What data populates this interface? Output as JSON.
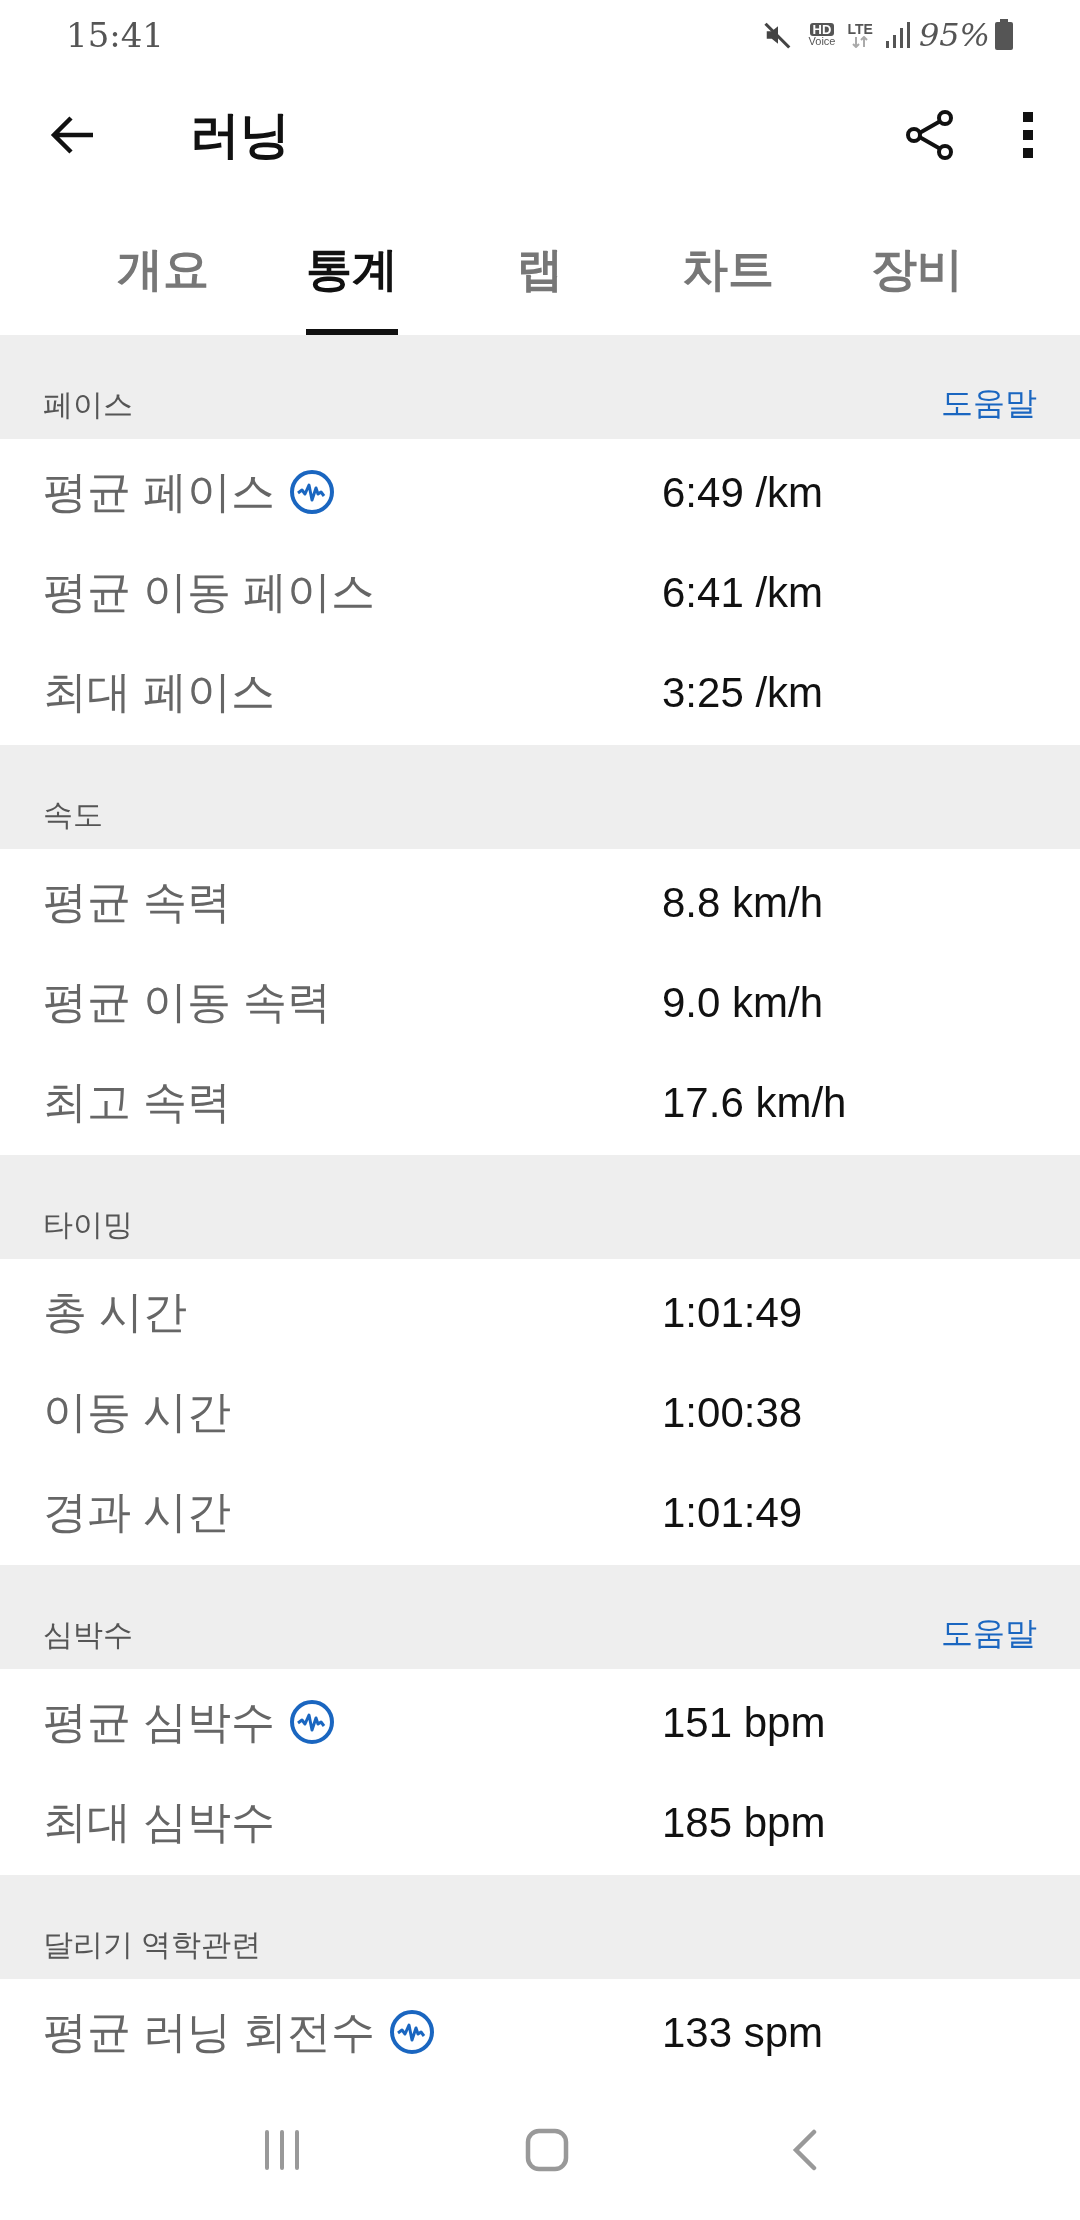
{
  "status_bar": {
    "time": "15:41",
    "hd": "HD",
    "voice": "Voice",
    "lte": "LTE",
    "battery": "95%"
  },
  "app_bar": {
    "title": "러닝"
  },
  "tabs": [
    {
      "label": "개요",
      "selected": false
    },
    {
      "label": "통계",
      "selected": true
    },
    {
      "label": "랩",
      "selected": false
    },
    {
      "label": "차트",
      "selected": false
    },
    {
      "label": "장비",
      "selected": false
    }
  ],
  "sections": [
    {
      "title": "페이스",
      "help": "도움말",
      "rows": [
        {
          "label": "평균 페이스",
          "info": true,
          "value": "6:49 /km"
        },
        {
          "label": "평균 이동 페이스",
          "info": false,
          "value": "6:41 /km"
        },
        {
          "label": "최대 페이스",
          "info": false,
          "value": "3:25 /km"
        }
      ]
    },
    {
      "title": "속도",
      "rows": [
        {
          "label": "평균 속력",
          "info": false,
          "value": "8.8 km/h"
        },
        {
          "label": "평균 이동 속력",
          "info": false,
          "value": "9.0 km/h"
        },
        {
          "label": "최고 속력",
          "info": false,
          "value": "17.6 km/h"
        }
      ]
    },
    {
      "title": "타이밍",
      "rows": [
        {
          "label": "총 시간",
          "info": false,
          "value": "1:01:49"
        },
        {
          "label": "이동 시간",
          "info": false,
          "value": "1:00:38"
        },
        {
          "label": "경과 시간",
          "info": false,
          "value": "1:01:49"
        }
      ]
    },
    {
      "title": "심박수",
      "help": "도움말",
      "rows": [
        {
          "label": "평균 심박수",
          "info": true,
          "value": "151 bpm"
        },
        {
          "label": "최대 심박수",
          "info": false,
          "value": "185 bpm"
        }
      ]
    },
    {
      "title": "달리기 역학관련",
      "rows": [
        {
          "label": "평균 러닝 회전수",
          "info": true,
          "value": "133 spm"
        }
      ]
    }
  ]
}
